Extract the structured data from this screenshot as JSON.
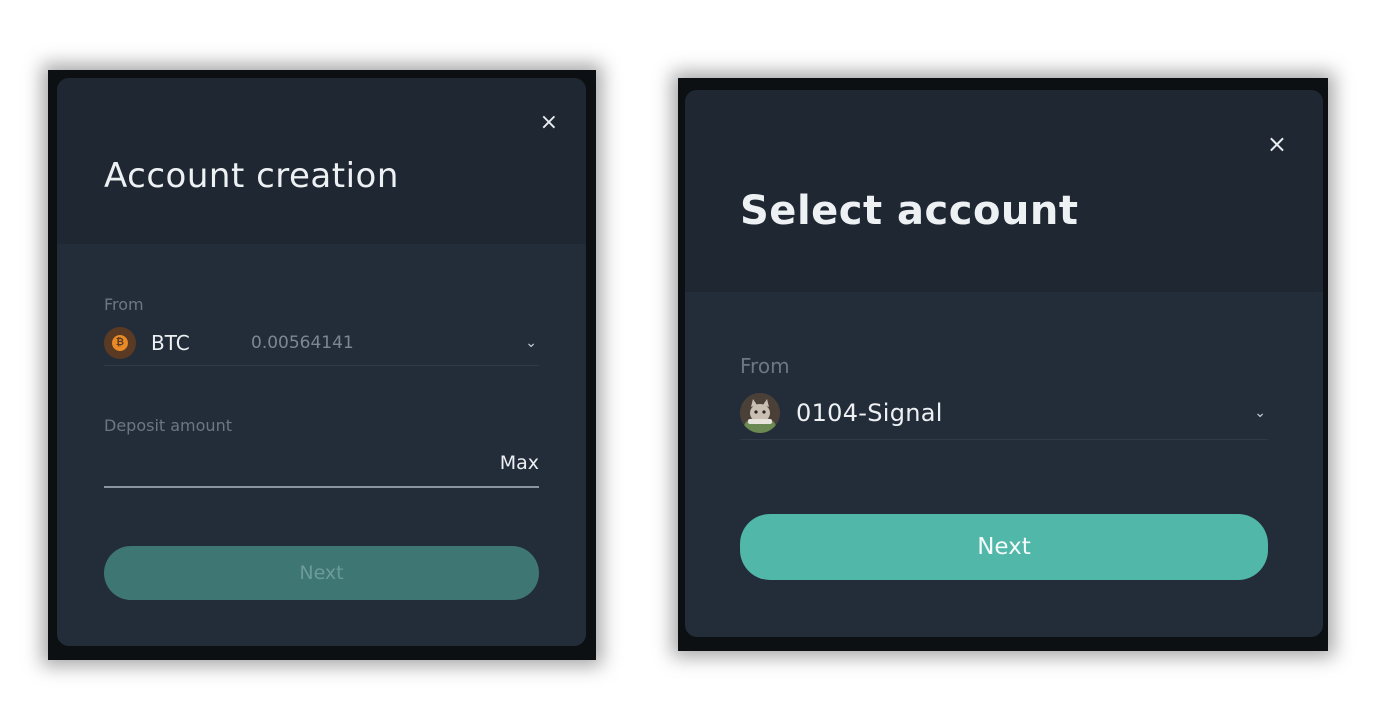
{
  "account_creation": {
    "title": "Account creation",
    "close_symbol": "×",
    "from_label": "From",
    "coin": {
      "icon": "bitcoin-icon",
      "symbol": "₿",
      "name": "BTC",
      "balance": "0.00564141"
    },
    "deposit_label": "Deposit amount",
    "deposit_value": "",
    "max_label": "Max",
    "next_label": "Next",
    "next_enabled": false
  },
  "select_account": {
    "title": "Select account",
    "close_symbol": "×",
    "from_label": "From",
    "account": {
      "avatar": "account-avatar",
      "name": "0104-Signal"
    },
    "next_label": "Next",
    "next_enabled": true
  },
  "colors": {
    "modal_bg": "#232d39",
    "header_bg": "#1f2832",
    "accent": "#51b7a8",
    "accent_disabled": "#3e7674",
    "bitcoin": "#e98a27"
  },
  "icons": {
    "chevron": "chevron-down-icon",
    "close": "close-icon"
  }
}
